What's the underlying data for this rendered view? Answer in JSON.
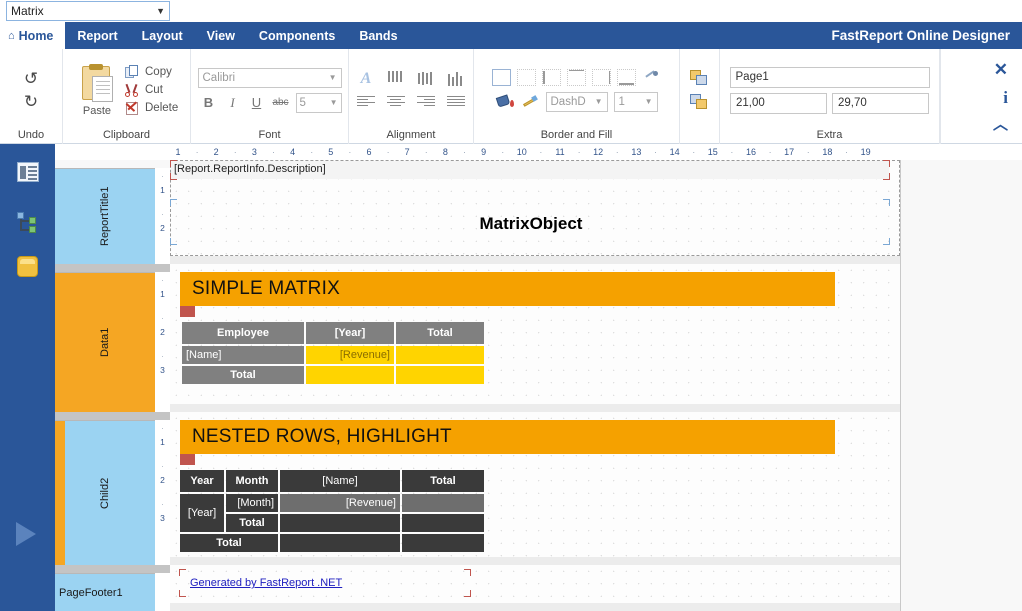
{
  "report_selector": {
    "value": "Matrix",
    "caret": "▼"
  },
  "menubar": {
    "brand": "FastReport Online Designer",
    "home_icon": "home-icon",
    "items": [
      {
        "label": "Home",
        "active": true
      },
      {
        "label": "Report",
        "active": false
      },
      {
        "label": "Layout",
        "active": false
      },
      {
        "label": "View",
        "active": false
      },
      {
        "label": "Components",
        "active": false
      },
      {
        "label": "Bands",
        "active": false
      }
    ]
  },
  "ribbon": {
    "undo": {
      "title": "Undo",
      "undo_icon": "undo-arrow-icon",
      "redo_icon": "redo-arrow-icon",
      "undo_glyph": "↺",
      "redo_glyph": "↻"
    },
    "clipboard": {
      "title": "Clipboard",
      "paste_label": "Paste",
      "copy_label": "Copy",
      "cut_label": "Cut",
      "delete_label": "Delete"
    },
    "font": {
      "title": "Font",
      "family": "Calibri",
      "size": "5",
      "bold": "B",
      "italic": "I",
      "underline": "U",
      "strike": "abc",
      "caret": "▼"
    },
    "alignment": {
      "title": "Alignment",
      "rotate_icon": "text-rotate-icon",
      "valign_top_icon": "align-top-icon",
      "valign_middle_icon": "align-middle-icon",
      "valign_bottom_icon": "align-bottom-icon",
      "halign_left_icon": "align-left-icon",
      "halign_center_icon": "align-center-icon",
      "halign_right_icon": "align-right-icon",
      "halign_justify_icon": "align-justify-icon"
    },
    "border": {
      "title": "Border and Fill",
      "dash_style": "DashD",
      "width": "1",
      "caret": "▼",
      "all_borders_icon": "border-all-icon",
      "no_border_icon": "border-none-icon",
      "left_border_icon": "border-left-icon",
      "top_border_icon": "border-top-icon",
      "right_border_icon": "border-right-icon",
      "bottom_border_icon": "border-bottom-icon",
      "border_color_icon": "border-color-icon",
      "fill_icon": "fill-bucket-icon",
      "brush_icon": "brush-icon"
    },
    "arrange": {
      "bring_front_icon": "bring-to-front-icon",
      "send_back_icon": "send-to-back-icon"
    },
    "extra": {
      "title": "Extra",
      "page_name": "Page1",
      "page_width": "21,00",
      "page_height": "29,70"
    },
    "right_tools": {
      "fullscreen_icon": "fullscreen-icon",
      "fullscreen_glyph": "✕",
      "info_icon": "info-icon",
      "info_glyph": "i",
      "collapse_icon": "chevron-up-icon",
      "collapse_glyph": "︿"
    }
  },
  "left_rail": {
    "report_tree_icon": "report-tree-icon",
    "data_tree_icon": "data-tree-icon",
    "database_icon": "database-icon",
    "preview_icon": "play-preview-icon"
  },
  "canvas": {
    "h_ruler_ticks": [
      "1",
      "2",
      "3",
      "4",
      "5",
      "6",
      "7",
      "8",
      "9",
      "10",
      "11",
      "12",
      "13",
      "14",
      "15",
      "16",
      "17",
      "18",
      "19"
    ],
    "h_ruler_dot": "·",
    "bands": [
      {
        "name": "ReportTitle1",
        "v_ticks": [
          "1",
          "2"
        ]
      },
      {
        "name": "Data1",
        "v_ticks": [
          "1",
          "2",
          "3"
        ]
      },
      {
        "name": "Child2",
        "v_ticks": [
          "1",
          "2",
          "3"
        ]
      },
      {
        "name": "PageFooter1",
        "v_ticks": []
      }
    ],
    "description_field": "[Report.ReportInfo.Description]",
    "report_heading": "MatrixObject",
    "matrix1": {
      "banner": "SIMPLE MATRIX",
      "columns": [
        "Employee",
        "[Year]",
        "Total"
      ],
      "rows": [
        {
          "cells": [
            "[Name]",
            "[Revenue]",
            ""
          ]
        },
        {
          "cells": [
            "Total",
            "",
            ""
          ]
        }
      ]
    },
    "matrix2": {
      "banner": "NESTED ROWS, HIGHLIGHT",
      "columns": [
        "Year",
        "Month",
        "[Name]",
        "Total"
      ],
      "rows": [
        {
          "cells": [
            "[Year]",
            "[Month]",
            "[Revenue]",
            ""
          ]
        },
        {
          "cells": [
            "",
            "Total",
            "",
            ""
          ]
        },
        {
          "cells": [
            "Total",
            "",
            "",
            ""
          ]
        }
      ]
    },
    "footer_link": "Generated by FastReport .NET"
  },
  "colors": {
    "menubar_blue": "#2a5699",
    "band_blue": "#9bd3f2",
    "band_orange": "#f5a623",
    "banner_orange": "#f5a100",
    "header_gray": "#808080",
    "gold_cell": "#ffd400",
    "dark_cell": "#3a3a3a",
    "highlight_cell": "#6e6e6e",
    "link_blue": "#2020c0"
  }
}
